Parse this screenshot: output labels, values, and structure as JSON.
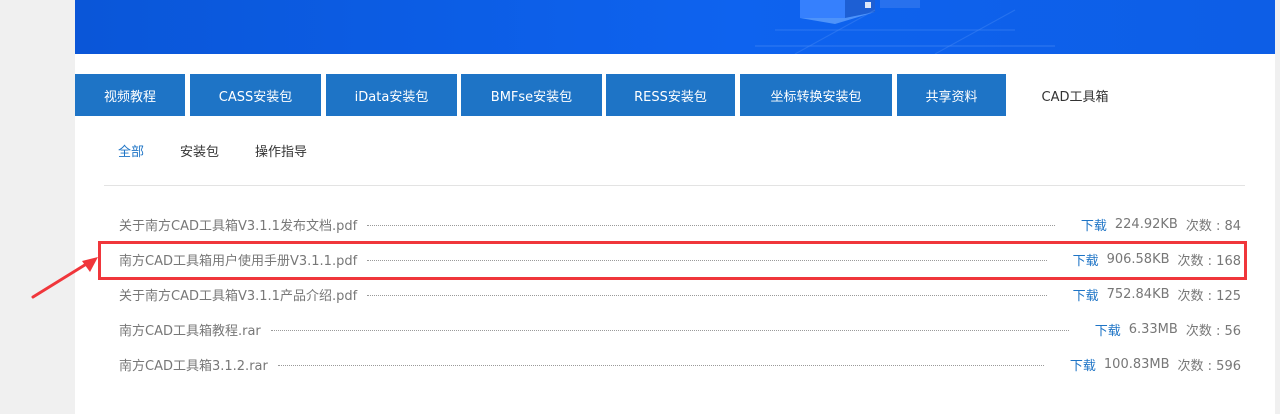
{
  "tabs": [
    {
      "label": "视频教程",
      "active": false
    },
    {
      "label": "CASS安装包",
      "active": false
    },
    {
      "label": "iData安装包",
      "active": false
    },
    {
      "label": "BMFse安装包",
      "active": false
    },
    {
      "label": "RESS安装包",
      "active": false
    },
    {
      "label": "坐标转换安装包",
      "active": false
    },
    {
      "label": "共享资料",
      "active": false
    },
    {
      "label": "CAD工具箱",
      "active": true
    }
  ],
  "filters": [
    {
      "label": "全部",
      "active": true
    },
    {
      "label": "安装包",
      "active": false
    },
    {
      "label": "操作指导",
      "active": false
    }
  ],
  "files": [
    {
      "name": "关于南方CAD工具箱V3.1.1发布文档.pdf",
      "download": "下载",
      "size": "224.92KB",
      "count": "次数 : 84"
    },
    {
      "name": "南方CAD工具箱用户使用手册V3.1.1.pdf",
      "download": "下载",
      "size": "906.58KB",
      "count": "次数 : 168"
    },
    {
      "name": "关于南方CAD工具箱V3.1.1产品介绍.pdf",
      "download": "下载",
      "size": "752.84KB",
      "count": "次数 : 125"
    },
    {
      "name": "南方CAD工具箱教程.rar",
      "download": "下载",
      "size": "6.33MB",
      "count": "次数 : 56"
    },
    {
      "name": "南方CAD工具箱3.1.2.rar",
      "download": "下载",
      "size": "100.83MB",
      "count": "次数 : 596"
    }
  ],
  "annotation": {
    "highlighted_row": 1,
    "color": "#f0363b"
  },
  "colors": {
    "accent": "#1e74c6",
    "banner": "#0e63ef"
  }
}
